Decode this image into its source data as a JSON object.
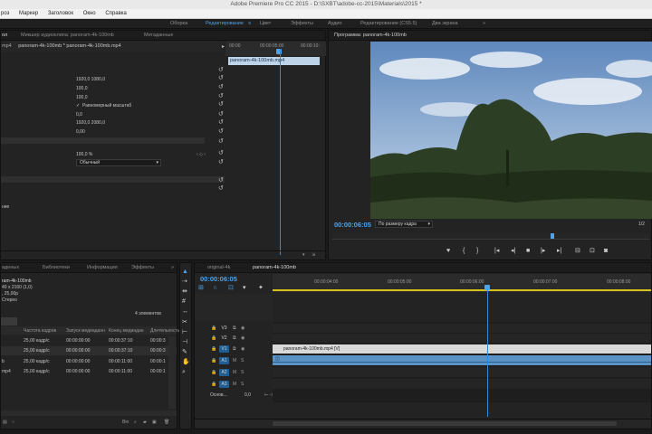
{
  "window": {
    "title": "Adobe Premiere Pro CC 2015 - D:\\SXBT\\adobe-cc-2015\\Materials\\2015 *"
  },
  "menu": [
    "роз",
    "Маркер",
    "Заголовок",
    "Окно",
    "Справка"
  ],
  "workspaces": [
    "Оборка",
    "Редактирование",
    "≡",
    "Цвет",
    "Эффекты",
    "Аудио",
    "Редактирование (CS5.5)",
    "Два экрана",
    "»"
  ],
  "effect_controls": {
    "tabs": [
      "Микшер аудиоклипа: panoram-4k-100mb",
      "Метаданные"
    ],
    "source_clip": "mp4",
    "sequence_clip": "panoram-4k-100mb * panoram-4k-100mb.mp4",
    "ruler_times": [
      "00:00",
      "00:00:05:00",
      "00:00:10:"
    ],
    "clip_bar_label": "panoram-4k-100mb.mp4",
    "position": "1920,0   1080,0",
    "scale": "100,0",
    "scale_width": "100,0",
    "uniform_scale": "Равномерный масштаб",
    "rotation": "0,0",
    "anchor": "1920,0   2080,0",
    "antiflicker": "0,00",
    "opacity": "100,0 %",
    "blend_mode": "Обычный",
    "left_label": "ние"
  },
  "program_monitor": {
    "title": "Программа: panoram-4k-100mb",
    "timecode": "00:00:06:05",
    "fit": "По размеру кадра",
    "resolution": "1/2"
  },
  "project": {
    "tabs": [
      "аденых",
      "Библиотеки",
      "Информация",
      "Эффекты",
      "»"
    ],
    "info_name": "ram-4k-100mb",
    "info_lines": [
      "40 x 2160 (1,0)",
      ", 25,00p",
      "Стерео"
    ],
    "count": "4 элементов",
    "columns": [
      "Частота кадров",
      "Запуск медиаданн",
      "Конец медиадан",
      "Длительность"
    ],
    "rows": [
      [
        "25,00 кадр/с",
        "00:00:00:00",
        "00:00:37:10",
        "00:00:3"
      ],
      [
        "25,00 кадр/с",
        "00:00:00:00",
        "00:00:37:10",
        "00:00:3"
      ],
      [
        "25,00 кадр/с",
        "00:00:00:00",
        "00:00:11:00",
        "00:00:1"
      ],
      [
        "25,00 кадр/с",
        "00:00:00:00",
        "00:00:11:00",
        "00:00:1"
      ]
    ],
    "row_names": [
      "",
      "",
      "b",
      "mp4"
    ]
  },
  "timeline": {
    "tabs": [
      "original-4k",
      "panoram-4k-100mb"
    ],
    "timecode": "00:00:06:05",
    "ruler": [
      "00:00:04:00",
      "00:00:05:00",
      "00:00:06:00",
      "00:00:07:00",
      "00:00:08:00"
    ],
    "tracks": [
      "V3",
      "V2",
      "V1",
      "A1",
      "A2",
      "A3"
    ],
    "master": "Основ...",
    "master_value": "0,0",
    "clip_label": "panoram-4k-100mb.mp4 [V]"
  },
  "colors": {
    "accent": "#4ea2e8",
    "playhead": "#2a8adb",
    "clip_video": "#d9d9d9",
    "clip_audio": "#5a93c4",
    "work_area": "#d6c21a"
  }
}
